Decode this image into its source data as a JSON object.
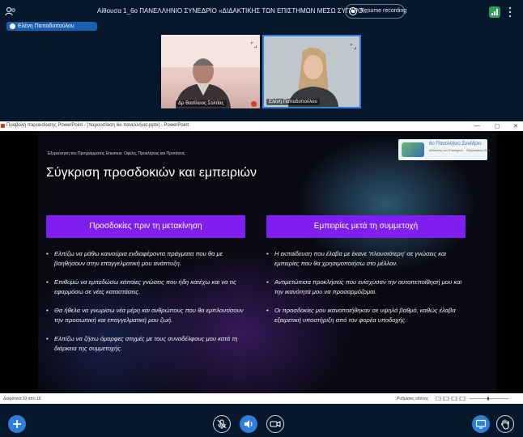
{
  "top_bar": {
    "room_title": "Αίθουσα 1_6ο ΠΑΝΕΛΛΗΝΙΟ ΣΥΝΕΔΡΙΟ «ΔΙΔΑΚΤΙΚΗΣ ΤΩΝ ΕΠΙΣΤΗΜΩΝ ΜΕΣΩ ΣΥΓΧΡΟ...",
    "recording_label": "Resume recording",
    "presenter_name": "Ελένη Παπαδοπούλου"
  },
  "videos": [
    {
      "name": "Δρ Βασίλειος Σολτίας",
      "muted": true
    },
    {
      "name": "Ελένη Παπαδοπούλου",
      "muted": false
    }
  ],
  "powerpoint": {
    "window_title": "Προβολή παρουσίασης PowerPoint - [παρουσίαση 6ο πανελλήνιο.pptx] - PowerPoint",
    "status_left": "Διαφάνεια 10 από 16",
    "status_right": "Ρυθμίσεις οθόνης"
  },
  "slide": {
    "header": "Εξερεύνηση του Προγράμματος Erasmus: Οφέλη, Προκλήσεις και Προτάσεις",
    "title": "Σύγκριση προσδοκιών και εμπειριών",
    "logo_title": "6ο Πανελλήνιο Συνέδριο",
    "logo_subtitle": "Διδακτικής των Επιστημών",
    "logo_date": "Φεβρουάριος 2024",
    "left_column": {
      "heading": "Προσδοκίες πριν τη μετακίνηση",
      "items": [
        "Ελπίζω να μάθω καινούρια ενδιαφέροντα πράγματα που θα με βοηθήσουν στην επαγγελματική μου ανάπτυξη.",
        "Επιθυμώ να εμπεδώσω κάποιες γνώσεις που ήδη κατέχω και να τις εφαρμόσω σε νέες καταστάσεις.",
        "Θα ήθελα να γνωρίσω νέα μέρη και ανθρώπους που θα εμπλουτίσουν την προσωπική και επαγγελματική μου ζωή.",
        "Ελπίζω να ζήσω όμορφες στιγμές με τους συναδέλφους μου κατά τη διάρκεια της συμμετοχής."
      ]
    },
    "right_column": {
      "heading": "Εμπειρίες μετά τη συμμετοχή",
      "items": [
        "Η εκπαίδευση που έλαβα με έκανε 'πλουσιότερη' σε γνώσεις και εμπειρίες που θα χρησιμοποιήσω στο μέλλον.",
        "Αντιμετώπισα προκλήσεις που ενίσχυσαν την αυτοπεποίθησή μου και την ικανότητά μου να προσαρμόζομαι.",
        "Οι προσδοκίες μου ικανοποιήθηκαν σε υψηλό βαθμό, καθώς έλαβα εξαιρετική υποστήριξη από τον φορέα υποδοχής."
      ]
    }
  },
  "colors": {
    "accent": "#2d7fd9",
    "column_heading": "#7e1ff0",
    "background": "#06172b"
  }
}
